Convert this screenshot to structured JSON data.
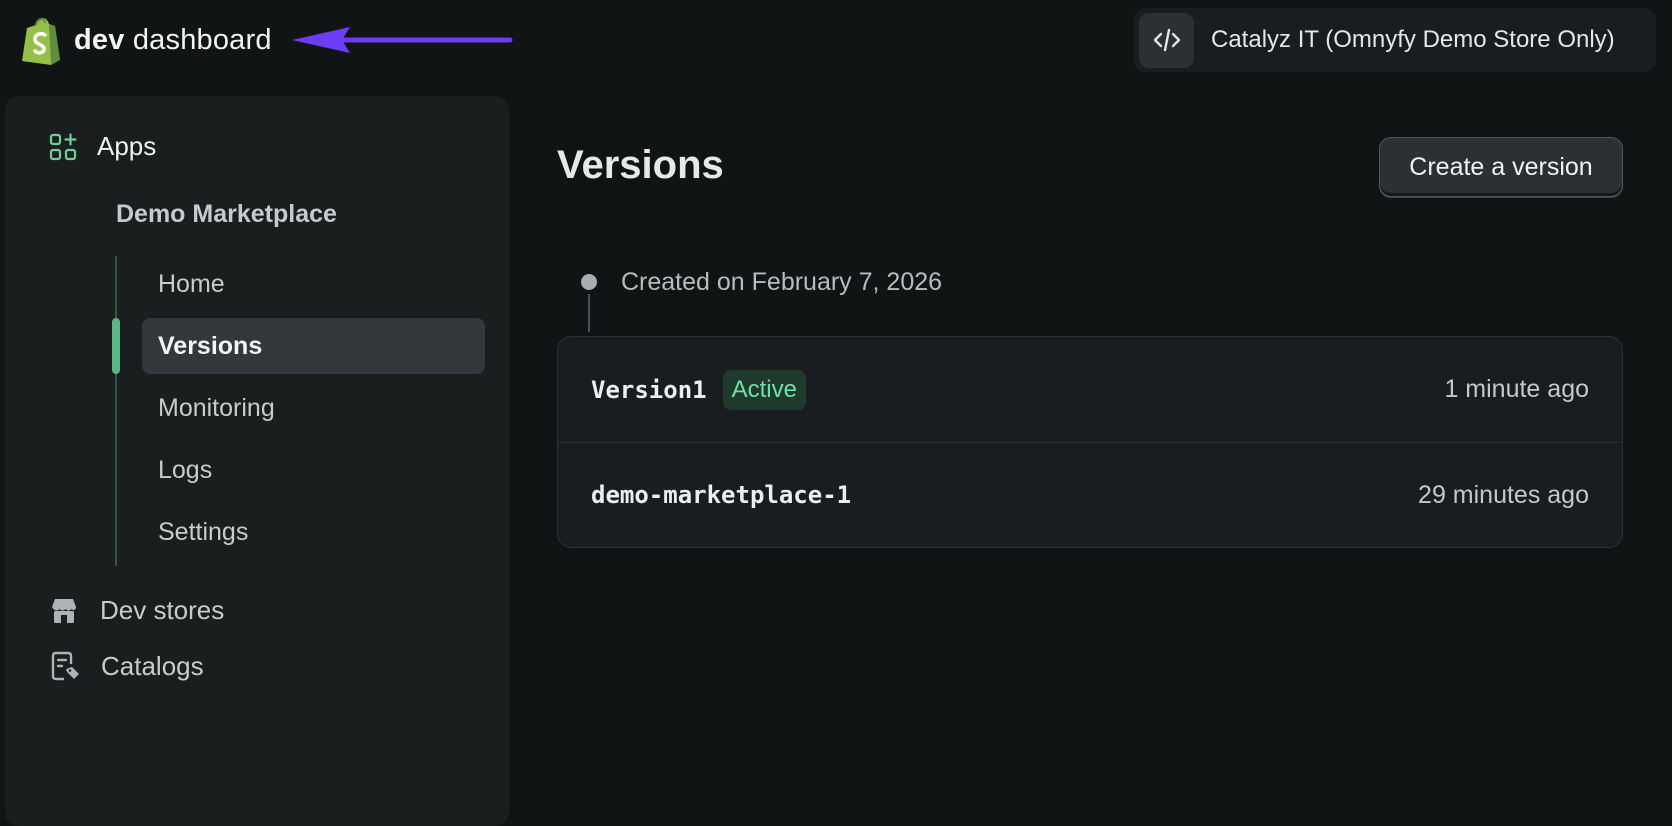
{
  "header": {
    "brand_bold": "dev",
    "brand_rest": " dashboard",
    "org_name": "Catalyz IT (Omnyfy Demo Store Only)",
    "accent_color": "#6d3df5"
  },
  "sidebar": {
    "apps_label": "Apps",
    "app_name": "Demo Marketplace",
    "items": [
      {
        "label": "Home"
      },
      {
        "label": "Versions"
      },
      {
        "label": "Monitoring"
      },
      {
        "label": "Logs"
      },
      {
        "label": "Settings"
      }
    ],
    "active_item": "Versions",
    "dev_stores_label": "Dev stores",
    "catalogs_label": "Catalogs"
  },
  "main": {
    "title": "Versions",
    "create_button": "Create a version",
    "timeline_label": "Created on February 7, 2026",
    "versions": [
      {
        "name": "Version1",
        "badge": "Active",
        "time": "1 minute ago"
      },
      {
        "name": "demo-marketplace-1",
        "badge": "",
        "time": "29 minutes ago"
      }
    ]
  }
}
